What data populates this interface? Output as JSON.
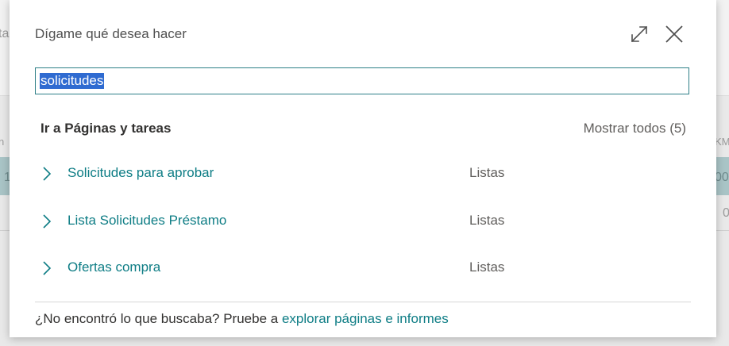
{
  "background": {
    "left_fragments": [
      "ta",
      "n",
      "1"
    ],
    "right_fragments": [
      "KM",
      "00",
      "0"
    ]
  },
  "dialog": {
    "title": "Dígame qué desea hacer",
    "search": {
      "value": "solicitudes"
    },
    "section_title": "Ir a Páginas y tareas",
    "show_all": "Mostrar todos (5)",
    "results": [
      {
        "name": "Solicitudes para aprobar",
        "category": "Listas"
      },
      {
        "name": "Lista Solicitudes Préstamo",
        "category": "Listas"
      },
      {
        "name": "Ofertas compra",
        "category": "Listas"
      }
    ],
    "footer": {
      "prefix": "¿No encontró lo que buscaba? Pruebe a ",
      "link": "explorar páginas e informes"
    }
  },
  "icons": {
    "expand": "expand-icon",
    "close": "close-icon",
    "chevron": "chevron-right-icon"
  },
  "colors": {
    "accent": "#0e7d85",
    "selection": "#2f6bd1",
    "search_border": "#2e7f87"
  }
}
